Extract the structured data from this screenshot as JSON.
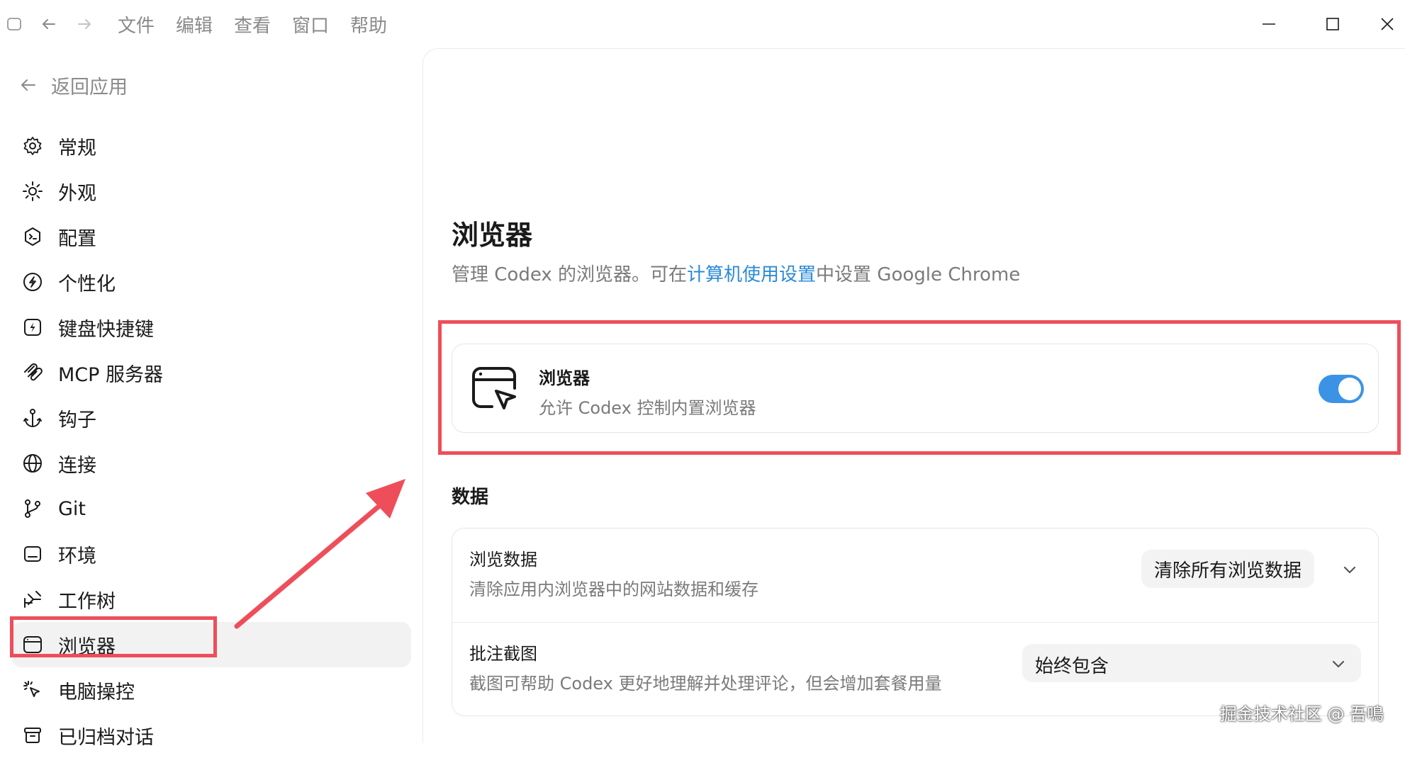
{
  "menu": {
    "items": [
      "文件",
      "编辑",
      "查看",
      "窗口",
      "帮助"
    ]
  },
  "sidebar": {
    "back_label": "返回应用",
    "items": [
      {
        "label": "常规",
        "icon": "gear-icon"
      },
      {
        "label": "外观",
        "icon": "sun-icon"
      },
      {
        "label": "配置",
        "icon": "shield-code-icon"
      },
      {
        "label": "个性化",
        "icon": "personalize-icon"
      },
      {
        "label": "键盘快捷键",
        "icon": "lightning-icon"
      },
      {
        "label": "MCP 服务器",
        "icon": "mcp-icon"
      },
      {
        "label": "钩子",
        "icon": "anchor-icon"
      },
      {
        "label": "连接",
        "icon": "globe-icon"
      },
      {
        "label": "Git",
        "icon": "git-branch-icon"
      },
      {
        "label": "环境",
        "icon": "terminal-icon"
      },
      {
        "label": "工作树",
        "icon": "worktree-icon"
      },
      {
        "label": "浏览器",
        "icon": "browser-window-icon",
        "active": true
      },
      {
        "label": "电脑操控",
        "icon": "cursor-click-icon"
      },
      {
        "label": "已归档对话",
        "icon": "archive-icon"
      }
    ]
  },
  "page": {
    "title": "浏览器",
    "desc_prefix": "管理 Codex 的浏览器。可在",
    "desc_link": "计算机使用设置",
    "desc_suffix": "中设置 Google Chrome"
  },
  "browser_card": {
    "title": "浏览器",
    "subtitle": "允许 Codex 控制内置浏览器",
    "toggle_on": true,
    "icon": "browser-cursor-icon"
  },
  "data_section": {
    "title": "数据",
    "rows": [
      {
        "title": "浏览数据",
        "subtitle": "清除应用内浏览器中的网站数据和缓存",
        "action": "清除所有浏览数据"
      },
      {
        "title": "批注截图",
        "subtitle": "截图可帮助 Codex 更好地理解并处理评论，但会增加套餐用量",
        "value": "始终包含"
      }
    ]
  },
  "colors": {
    "accent": "#2a8bd8",
    "toggle": "#3b93e6",
    "annotation": "#ee4e5a"
  },
  "watermark": "掘金技术社区 @ 吾鳴"
}
